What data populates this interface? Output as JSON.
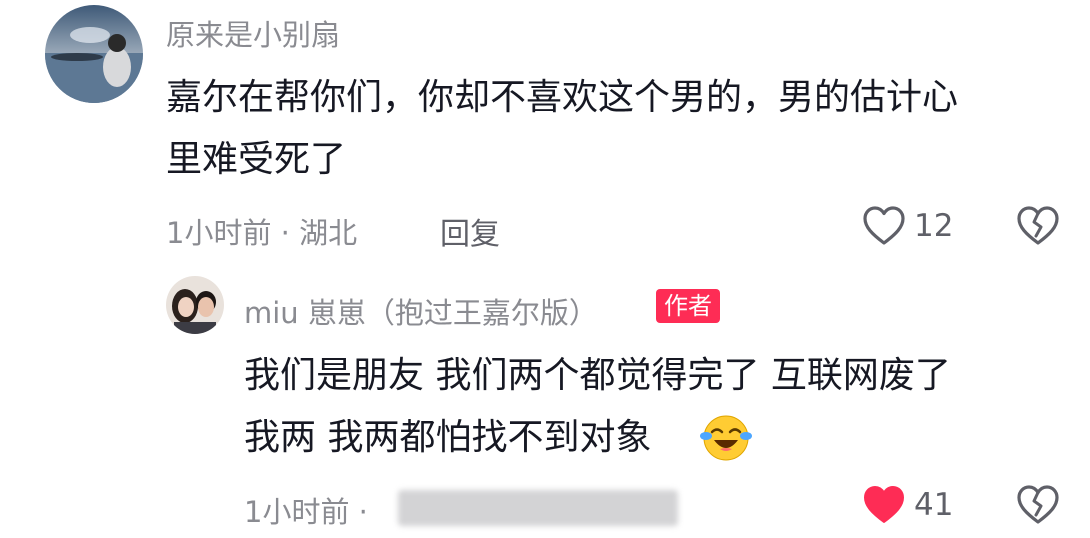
{
  "comment1": {
    "username": "原来是小别扇",
    "text_lines": [
      "嘉尔在帮你们，你却不喜欢这个男的，男的估计心",
      "里难受死了"
    ],
    "time": "1小时前",
    "location": "湖北",
    "reply_label": "回复",
    "likes": "12",
    "liked": false
  },
  "comment2": {
    "username": "miu 崽崽（抱过王嘉尔版）",
    "author_badge": "作者",
    "text_lines": [
      "我们是朋友 我们两个都觉得完了 互联网废了",
      "我两 我两都怕找不到对象"
    ],
    "time": "1小时前",
    "likes": "41",
    "liked": true,
    "like_color": "#fe2c55"
  },
  "icons": {
    "heart": "heart-icon",
    "dislike": "broken-heart-icon",
    "emoji": "crying-laughing-emoji"
  }
}
